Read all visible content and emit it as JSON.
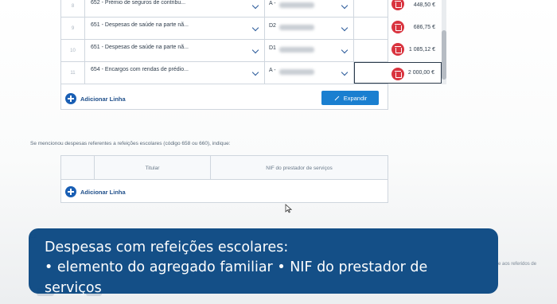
{
  "expenses_table": {
    "rows": [
      {
        "num": "8",
        "code": "652 - Prémio de seguros de contribu...",
        "titular": "A -",
        "value": "448,50 €"
      },
      {
        "num": "9",
        "code": "651 - Despesas de saúde na parte nã...",
        "titular": "D2",
        "value": "686,75 €"
      },
      {
        "num": "10",
        "code": "651 - Despesas de saúde na parte nã...",
        "titular": "D1",
        "value": "1 085,12 €"
      },
      {
        "num": "11",
        "code": "654 - Encargos com rendas de prédio...",
        "titular": "A -",
        "value": "2 000,00 €"
      }
    ],
    "add_line_label": "Adicionar Linha",
    "expand_label": "Expandir"
  },
  "meals_section": {
    "instruction": "Se mencionou despesas referentes a refeições escolares (código 658 ou 660), indique:",
    "columns": [
      "",
      "Titular",
      "NIF do prestador de serviços"
    ],
    "add_line_label": "Adicionar Linha"
  },
  "background_fragments": {
    "left_text": "C2",
    "right_text": "e aos referidos de"
  },
  "caption": {
    "line1": "Despesas com refeições escolares:",
    "line2": "• elemento do agregado familiar • NIF do prestador de serviços"
  },
  "colors": {
    "primary_blue": "#1a5fb4",
    "button_blue": "#1a7fd0",
    "delete_red": "#d9343f",
    "caption_bg": "#0d4a84"
  },
  "icons": [
    "plus-circle-icon",
    "chevron-down-icon",
    "trash-icon",
    "expand-icon",
    "mouse-cursor-icon"
  ]
}
